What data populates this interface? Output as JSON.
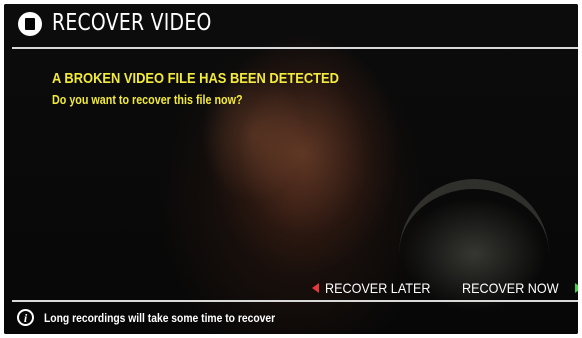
{
  "header": {
    "title": "RECOVER VIDEO",
    "icon": "camera-stop-icon"
  },
  "message": {
    "title": "A BROKEN VIDEO FILE HAS BEEN DETECTED",
    "question": "Do you want to recover this file now?"
  },
  "actions": {
    "recover_later": "RECOVER LATER",
    "recover_now": "RECOVER NOW"
  },
  "footer": {
    "info": "Long recordings will take some time to recover",
    "icon": "info-icon"
  },
  "colors": {
    "warning_text": "#f2ea3c",
    "later_arrow": "#e23a3a",
    "now_arrow": "#3fd13f",
    "rule": "#d9d9d9"
  }
}
